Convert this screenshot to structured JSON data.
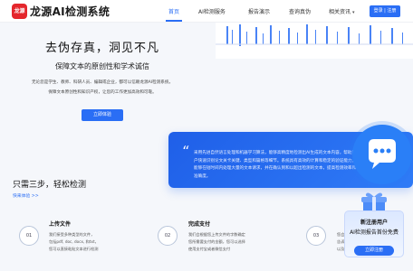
{
  "nav": {
    "brand": "龙源AI检测系统",
    "logo_text": "龙源",
    "items": [
      "首页",
      "AI检测服务",
      "报告演示",
      "查询真伪",
      "相关资讯"
    ],
    "login_label": "登录 | 注册"
  },
  "hero": {
    "title": "去伪存真，洞见不凡",
    "subtitle": "保障文本的原创性和学术诚信",
    "desc1": "无论您是学生、教师、科研人员、编辑或企业，都可以信赖龙源AI检测系统，",
    "desc2": "保障文本原创性和知识产权，让您的工作更加高效和可靠。",
    "cta": "立即体验"
  },
  "quote": {
    "text": "采用先进自然语言处理和机器学习算法，能够高精度地检测出AI生成的文本内容，帮助用户快速识别论文关卡关键、类型和篇格等细节。系统具有高效的计算和稳定的验证能力，能够在短时间内处理大量的文本请求，并在确认到和以超出检测的文本，提高检测效率和准确度。"
  },
  "steps": {
    "title": "只需三步，轻松检测",
    "link": "快来体验 >>",
    "items": [
      {
        "num": "01",
        "title": "上传文件",
        "desc": [
          "我们接受多种类型的文件，",
          "包括pdf, doc, docx, 和txt，",
          "您可以直接粘贴文本进行检测"
        ]
      },
      {
        "num": "02",
        "title": "完成支付",
        "desc": [
          "我们会根据您上传文件的字数确定",
          "您所需要支付的金额，您可以选择",
          "使用支付宝或者微信支付"
        ]
      },
      {
        "num": "03",
        "title": "",
        "desc": [
          "您会得到一份详细的检测报告，",
          "告诉您哪些段落可能是AI生成",
          "以及整体的相似度"
        ]
      }
    ]
  },
  "promo": {
    "line1": "新注册用户",
    "line2": "AI检测报告首份免费",
    "cta": "立即注册"
  },
  "colors": {
    "primary": "#2a6ef5",
    "logo": "#e4262c"
  },
  "icons": [
    "chat-bubble-icon",
    "gift-icon",
    "quote-icon"
  ]
}
